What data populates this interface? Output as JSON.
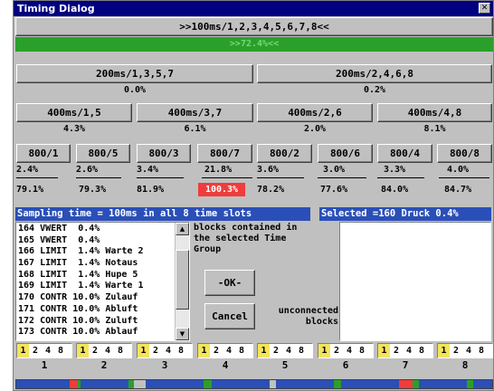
{
  "dialog": {
    "title": "Timing Dialog",
    "close_glyph": "✕"
  },
  "master": {
    "label": ">>100ms/1,2,3,4,5,6,7,8<<",
    "bar_text": ">>72.4%<<"
  },
  "level1": [
    {
      "label": "200ms/1,3,5,7",
      "pct": "0.0%"
    },
    {
      "label": "200ms/2,4,6,8",
      "pct": "0.2%"
    }
  ],
  "level2": [
    {
      "label": "400ms/1,5",
      "pct": "4.3%"
    },
    {
      "label": "400ms/3,7",
      "pct": "6.1%"
    },
    {
      "label": "400ms/2,6",
      "pct": "2.0%"
    },
    {
      "label": "400ms/4,8",
      "pct": "8.1%"
    }
  ],
  "level3": [
    {
      "label": "800/1",
      "pct": "2.4%",
      "total": "79.1%"
    },
    {
      "label": "800/5",
      "pct": "2.6%",
      "total": "79.3%"
    },
    {
      "label": "800/3",
      "pct": "3.4%",
      "total": "81.9%"
    },
    {
      "label": "800/7",
      "pct": "21.8%",
      "total": "100.3%"
    },
    {
      "label": "800/2",
      "pct": "3.6%",
      "total": "78.2%"
    },
    {
      "label": "800/6",
      "pct": "3.0%",
      "total": "77.6%"
    },
    {
      "label": "800/4",
      "pct": "3.3%",
      "total": "84.0%"
    },
    {
      "label": "800/8",
      "pct": "4.0%",
      "total": "84.7%"
    }
  ],
  "sampling_header": "Sampling time = 100ms in all 8 time slots",
  "selected_header": "Selected =160 Druck  0.4%",
  "blocks_list": [
    "164 VWERT  0.4%",
    "165 VWERT  0.4%",
    "166 LIMIT  1.4% Warte 2",
    "167 LIMIT  1.4% Notaus",
    "168 LIMIT  1.4% Hupe 5",
    "169 LIMIT  1.4% Warte 1",
    "170 CONTR 10.0% Zulauf",
    "171 CONTR 10.0% Abluft",
    "172 CONTR 10.0% Zuluft",
    "173 CONTR 10.0% Ablauf"
  ],
  "blocks_text": "blocks contained in the selected Time Group",
  "ok_label": "-OK-",
  "cancel_label": "Cancel",
  "unconnected_text": "unconnected blocks",
  "slots": [
    {
      "label": "1",
      "values": [
        "1",
        "2",
        "4",
        "8"
      ]
    },
    {
      "label": "2",
      "values": [
        "1",
        "2",
        "4",
        "8"
      ]
    },
    {
      "label": "3",
      "values": [
        "1",
        "2",
        "4",
        "8"
      ]
    },
    {
      "label": "4",
      "values": [
        "1",
        "2",
        "4",
        "8"
      ]
    },
    {
      "label": "5",
      "values": [
        "1",
        "2",
        "4",
        "8"
      ]
    },
    {
      "label": "6",
      "values": [
        "1",
        "2",
        "4",
        "8"
      ]
    },
    {
      "label": "7",
      "values": [
        "1",
        "2",
        "4",
        "8"
      ]
    },
    {
      "label": "8",
      "values": [
        "1",
        "2",
        "4",
        "8"
      ]
    }
  ],
  "colors": {
    "title_bar": "#000080",
    "master_bar": "#2aa02a",
    "header_bar": "#2a4fb8",
    "overload_red": "#f03c3c",
    "slot_highlight": "#f4e45c"
  }
}
